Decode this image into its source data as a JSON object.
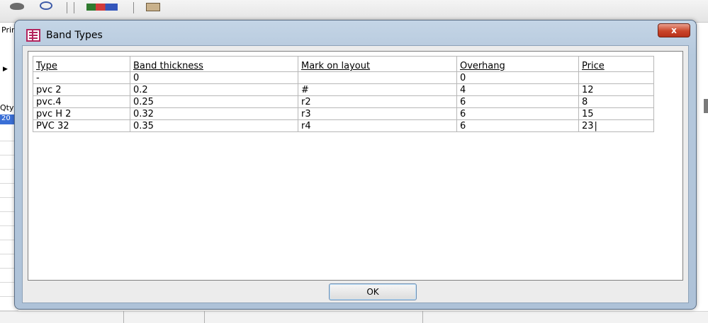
{
  "background": {
    "label_print": "Prin",
    "label_qty": "Qty",
    "selected_cell": "20"
  },
  "dialog": {
    "title": "Band Types",
    "close_label": "x",
    "table": {
      "columns": [
        "Type",
        "Band thickness",
        "Mark on layout",
        "Overhang",
        "Price"
      ],
      "new_row": [
        "-",
        "0",
        "",
        "0",
        ""
      ],
      "rows": [
        [
          "pvc 2",
          "0.2",
          "#",
          "4",
          "12"
        ],
        [
          "pvc.4",
          "0.25",
          "r2",
          "6",
          "8"
        ],
        [
          "pvc H 2",
          "0.32",
          "r3",
          "6",
          "15"
        ],
        [
          "PVC 32",
          "0.35",
          "r4",
          "6",
          "23"
        ]
      ]
    },
    "ok_label": "OK"
  }
}
